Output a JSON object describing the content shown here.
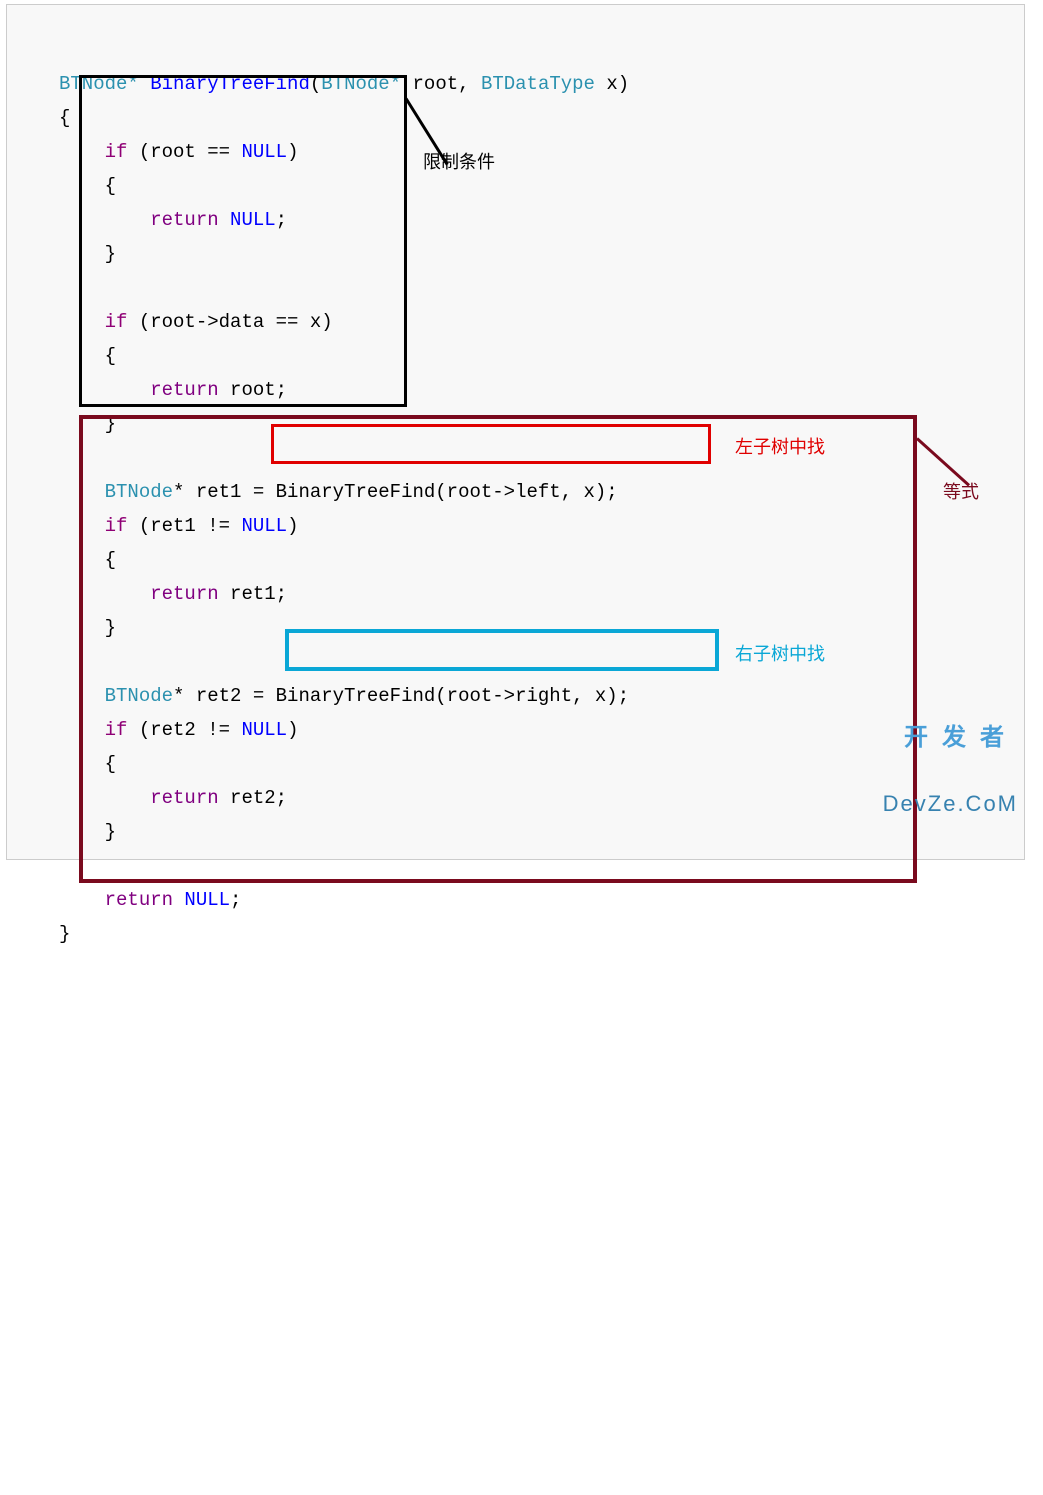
{
  "code": {
    "l01_type1": "BTNode",
    "l01_star1": "*",
    "l01_fn": "BinaryTreeFind",
    "l01_open": "(",
    "l01_type2": "BTNode",
    "l01_star2": "*",
    "l01_arg1": "root",
    "l01_comma": ",",
    "l01_type3": "BTDataType",
    "l01_arg2": "x",
    "l01_close": ")",
    "l02": "{",
    "l03_if": "if",
    "l03_cond_open": " (root == ",
    "l03_null": "NULL",
    "l03_cond_close": ")",
    "l04": "{",
    "l05_ret": "return",
    "l05_val": " NULL",
    "l05_semi": ";",
    "l06": "}",
    "l08_if": "if",
    "l08_cond": " (root->data == x)",
    "l09": "{",
    "l10_ret": "return",
    "l10_val": " root;",
    "l11": "}",
    "l13_type": "BTNode",
    "l13_rest": "* ret1 = BinaryTreeFind(root->left, x);",
    "l14_if": "if",
    "l14_cond_open": " (ret1 != ",
    "l14_null": "NULL",
    "l14_cond_close": ")",
    "l15": "{",
    "l16_ret": "return",
    "l16_val": " ret1;",
    "l17": "}",
    "l19_type": "BTNode",
    "l19_rest": "* ret2 = BinaryTreeFind(root->right, x);",
    "l20_if": "if",
    "l20_cond_open": " (ret2 != ",
    "l20_null": "NULL",
    "l20_cond_close": ")",
    "l21": "{",
    "l22_ret": "return",
    "l22_val": " ret2;",
    "l23": "}",
    "l25_ret": "return",
    "l25_val": " NULL",
    "l25_semi": ";",
    "l26": "}"
  },
  "annotations": {
    "black": "限制条件",
    "red": "左子树中找",
    "cyan": "右子树中找",
    "maroon": "等式"
  },
  "watermark": {
    "line1": "开发者",
    "line2": "DevZe.CoM"
  }
}
